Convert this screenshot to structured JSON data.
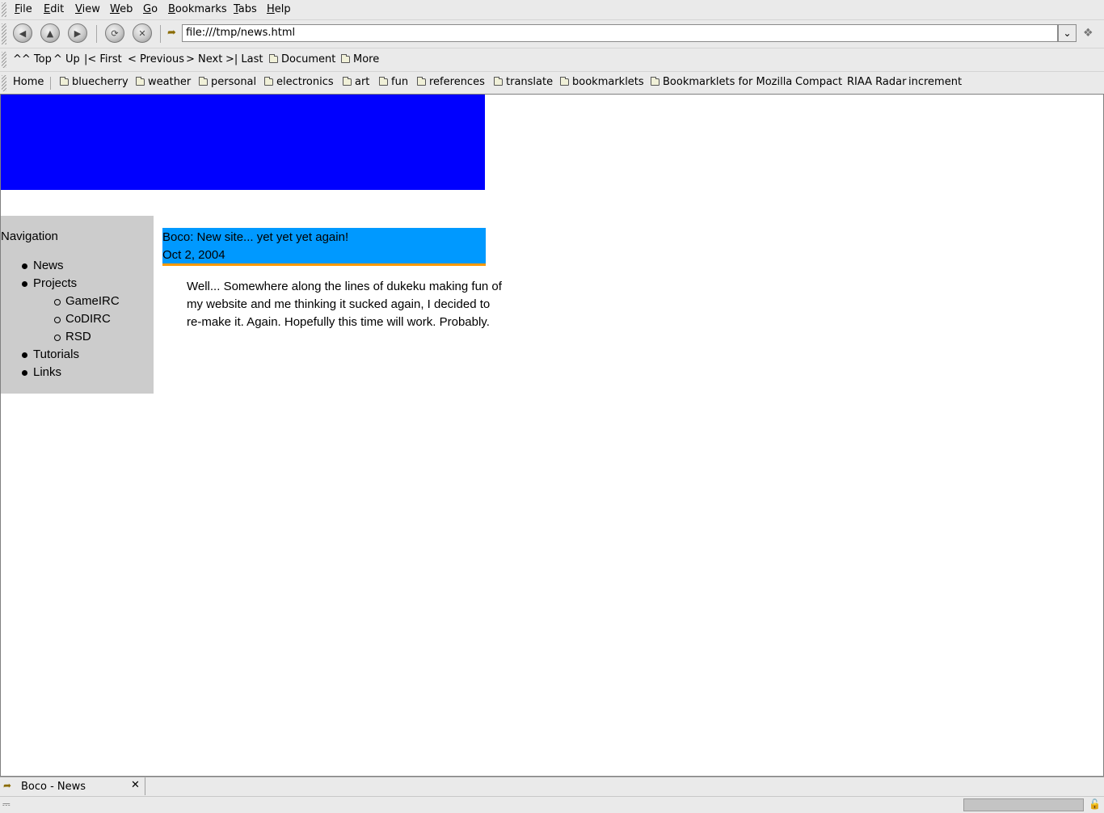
{
  "menubar": {
    "items": [
      {
        "mnemonic": "F",
        "rest": "ile"
      },
      {
        "mnemonic": "E",
        "rest": "dit"
      },
      {
        "mnemonic": "V",
        "rest": "iew"
      },
      {
        "mnemonic": "W",
        "rest": "eb"
      },
      {
        "mnemonic": "G",
        "rest": "o"
      },
      {
        "mnemonic": "B",
        "rest": "ookmarks"
      },
      {
        "mnemonic": "T",
        "rest": "abs"
      },
      {
        "mnemonic": "H",
        "rest": "elp"
      }
    ]
  },
  "navbar": {
    "back_icon": "back-arrow-icon",
    "forward_icon": "forward-arrow-icon",
    "home_icon": "home-icon",
    "reload_icon": "reload-icon",
    "stop_icon": "stop-icon",
    "url": "file:///tmp/news.html"
  },
  "sitenav": {
    "items": [
      "^^ Top",
      "^ Up",
      "|< First",
      "< Previous",
      "> Next",
      ">| Last",
      "Document",
      "More"
    ]
  },
  "personal_toolbar": {
    "home": "Home",
    "folders": [
      "bluecherry",
      "weather",
      "personal",
      "electronics",
      "art",
      "fun",
      "references",
      "translate",
      "bookmarklets",
      "Bookmarklets for Mozilla"
    ],
    "links": [
      "Compact",
      "RIAA Radar",
      "increment"
    ]
  },
  "page": {
    "banner_color": "#0000ff",
    "nav_heading": "Navigation",
    "nav_items": {
      "news": "News",
      "projects": "Projects",
      "gameirc": "GameIRC",
      "codirc": "CoDIRC",
      "rsd": "RSD",
      "tutorials": "Tutorials",
      "links": "Links"
    },
    "post": {
      "title": "Boco: New site... yet yet yet again!",
      "date": "Oct 2, 2004",
      "body_lines": [
        "Well... Somewhere along the lines of dukeku making fun of",
        "my website and me thinking it sucked again, I decided to",
        "re-make it. Again. Hopefully this time will work. Probably."
      ],
      "header_color": "#0099ff",
      "accent_color": "#ff9900"
    }
  },
  "tabbar": {
    "tab_label": "Boco - News"
  }
}
